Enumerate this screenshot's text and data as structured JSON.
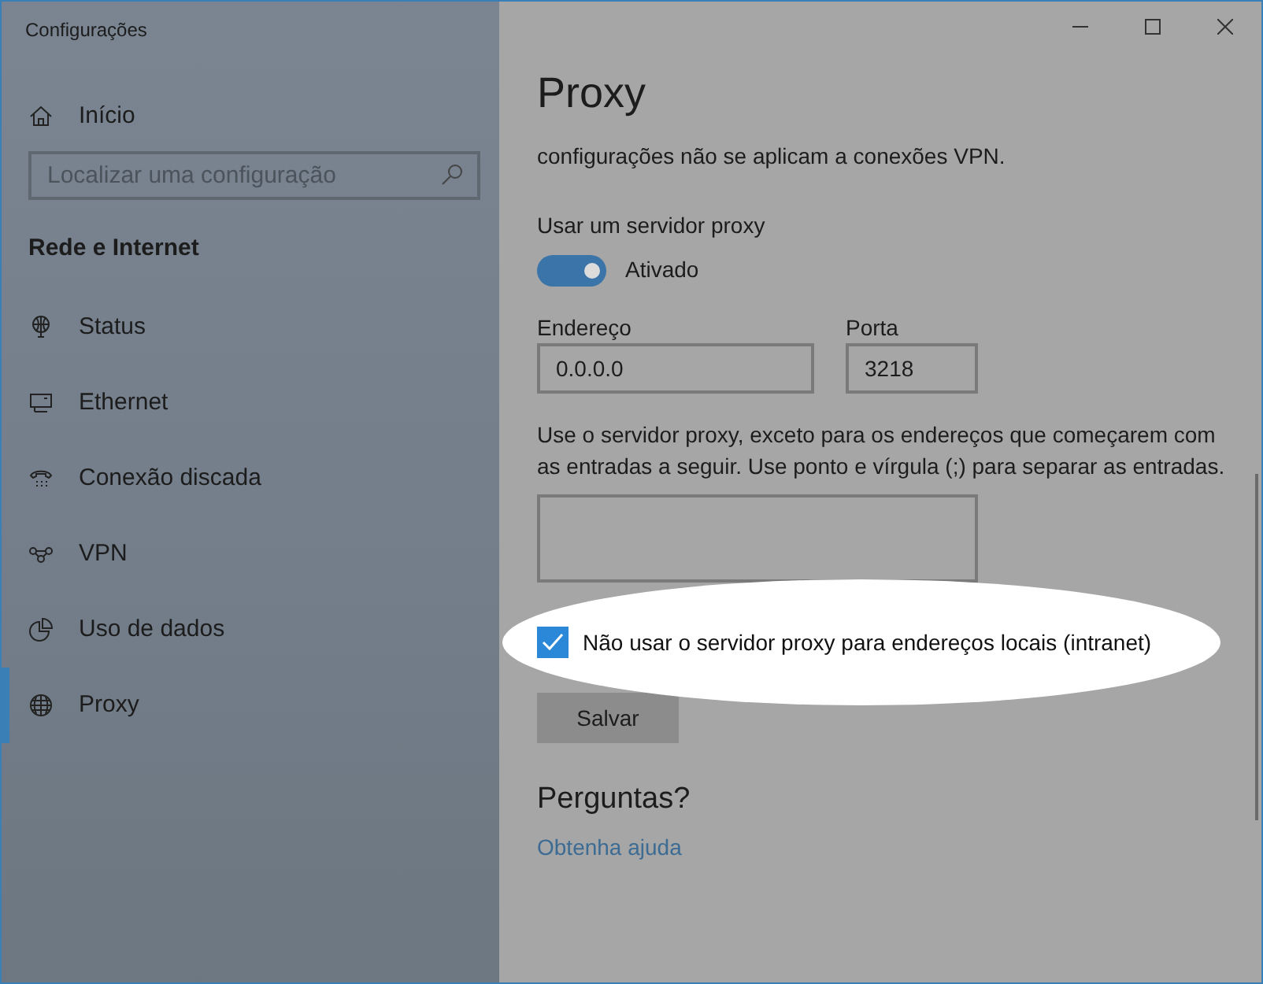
{
  "window": {
    "title": "Configurações"
  },
  "sidebar": {
    "home": "Início",
    "search": {
      "placeholder": "Localizar uma configuração"
    },
    "section": "Rede e Internet",
    "items": [
      {
        "label": "Status",
        "selected": false
      },
      {
        "label": "Ethernet",
        "selected": false
      },
      {
        "label": "Conexão discada",
        "selected": false
      },
      {
        "label": "VPN",
        "selected": false
      },
      {
        "label": "Uso de dados",
        "selected": false
      },
      {
        "label": "Proxy",
        "selected": true
      }
    ]
  },
  "content": {
    "title": "Proxy",
    "description": "configurações não se aplicam a conexões VPN.",
    "toggle": {
      "label": "Usar um servidor proxy",
      "on": true,
      "state": "Ativado"
    },
    "address": {
      "label": "Endereço",
      "value": "0.0.0.0"
    },
    "port": {
      "label": "Porta",
      "value": "3218"
    },
    "exceptions_text": "Use o servidor proxy, exceto para os endereços que começarem com as entradas a seguir. Use ponto e vírgula (;) para separar as entradas.",
    "local_checkbox": {
      "label": "Não usar o servidor proxy para endereços locais (intranet)",
      "checked": true
    },
    "save_button": "Salvar",
    "questions": "Perguntas?",
    "help_link": "Obtenha ajuda"
  }
}
